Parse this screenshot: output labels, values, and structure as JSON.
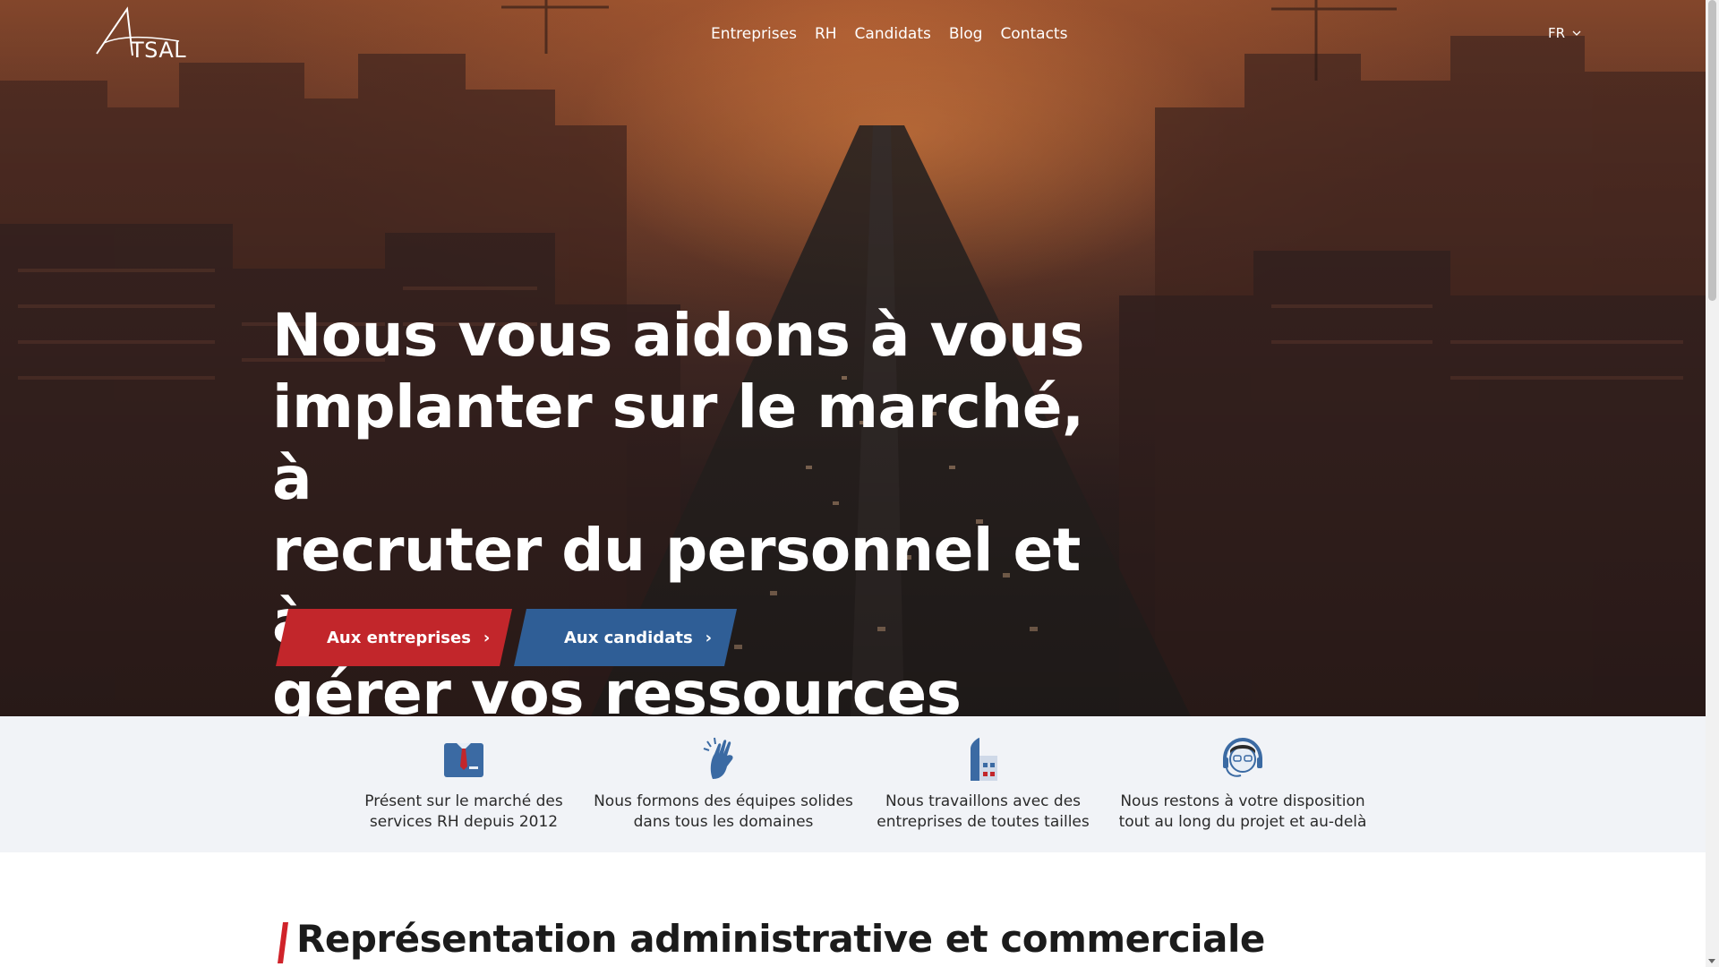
{
  "brand": {
    "logo_text": "TSAL"
  },
  "nav": {
    "items": [
      {
        "label": "Entreprises"
      },
      {
        "label": "RH"
      },
      {
        "label": "Candidats"
      },
      {
        "label": "Blog"
      },
      {
        "label": "Contacts"
      }
    ]
  },
  "language": {
    "current": "FR",
    "icon": "chevron-down-icon"
  },
  "hero": {
    "headline": "Nous vous aidons à vous\nimplanter sur le marché,   à\nrecruter du personnel et à\ngérer vos ressources",
    "cta_companies": "Aux entreprises",
    "cta_candidates": "Aux candidats",
    "colors": {
      "companies": "#c2262b",
      "candidates": "#2f5e96"
    }
  },
  "features": [
    {
      "icon": "business-suit-icon",
      "text": "Présent sur le marché des services RH depuis 2012"
    },
    {
      "icon": "high-five-hands-icon",
      "text": "Nous formons des équipes solides dans tous les domaines"
    },
    {
      "icon": "office-building-icon",
      "text": "Nous travaillons avec des entreprises de toutes tailles"
    },
    {
      "icon": "support-agent-headset-icon",
      "text": "Nous restons à votre disposition tout au long du projet et au-delà"
    }
  ],
  "section": {
    "title": "Représentation administrative et commerciale",
    "accent_color": "#d0232a"
  }
}
